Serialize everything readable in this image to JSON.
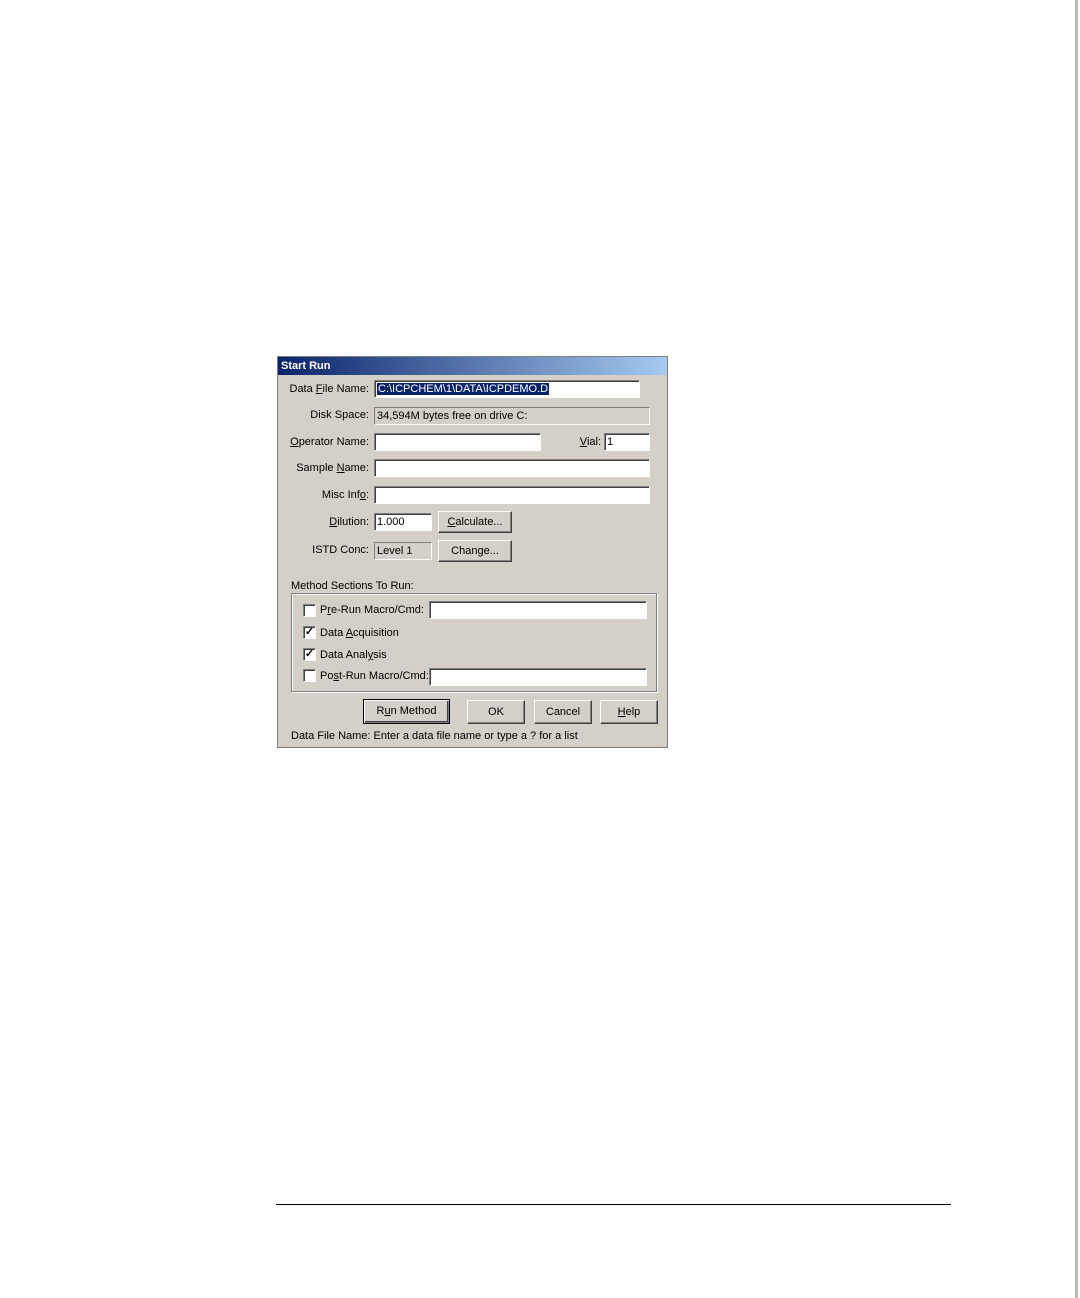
{
  "dialog": {
    "title": "Start Run",
    "data_file_name_label": "Data File Name:",
    "data_file_name_value": "C:\\ICPCHEM\\1\\DATA\\ICPDEMO.D",
    "disk_space_label": "Disk Space:",
    "disk_space_value": "34,594M bytes free on drive C:",
    "operator_name_label": "Operator Name:",
    "operator_name_value": "",
    "vial_label": "Vial:",
    "vial_value": "1",
    "sample_name_label": "Sample Name:",
    "sample_name_value": "",
    "misc_info_label": "Misc Info:",
    "misc_info_value": "",
    "dilution_label": "Dilution:",
    "dilution_value": "1.000",
    "calculate_button": "Calculate...",
    "istd_conc_label": "ISTD Conc:",
    "istd_conc_value": "Level 1",
    "change_button": "Change...",
    "method_sections_label": "Method Sections To Run:",
    "sections": {
      "pre_run": {
        "label": "Pre-Run Macro/Cmd:",
        "checked": false,
        "value": ""
      },
      "data_acquisition": {
        "label": "Data Acquisition",
        "checked": true
      },
      "data_analysis": {
        "label": "Data Analysis",
        "checked": true
      },
      "post_run": {
        "label": "Post-Run Macro/Cmd:",
        "checked": false,
        "value": ""
      }
    },
    "run_method_button": "Run Method",
    "ok_button": "OK",
    "cancel_button": "Cancel",
    "help_button": "Help",
    "status_text": "Data File Name: Enter a data file name or type a ? for a list"
  },
  "colors": {
    "dialog_bg": "#d4d0c8",
    "titlebar_start": "#0a246a",
    "titlebar_end": "#a6caf0",
    "selection": "#0a246a"
  }
}
